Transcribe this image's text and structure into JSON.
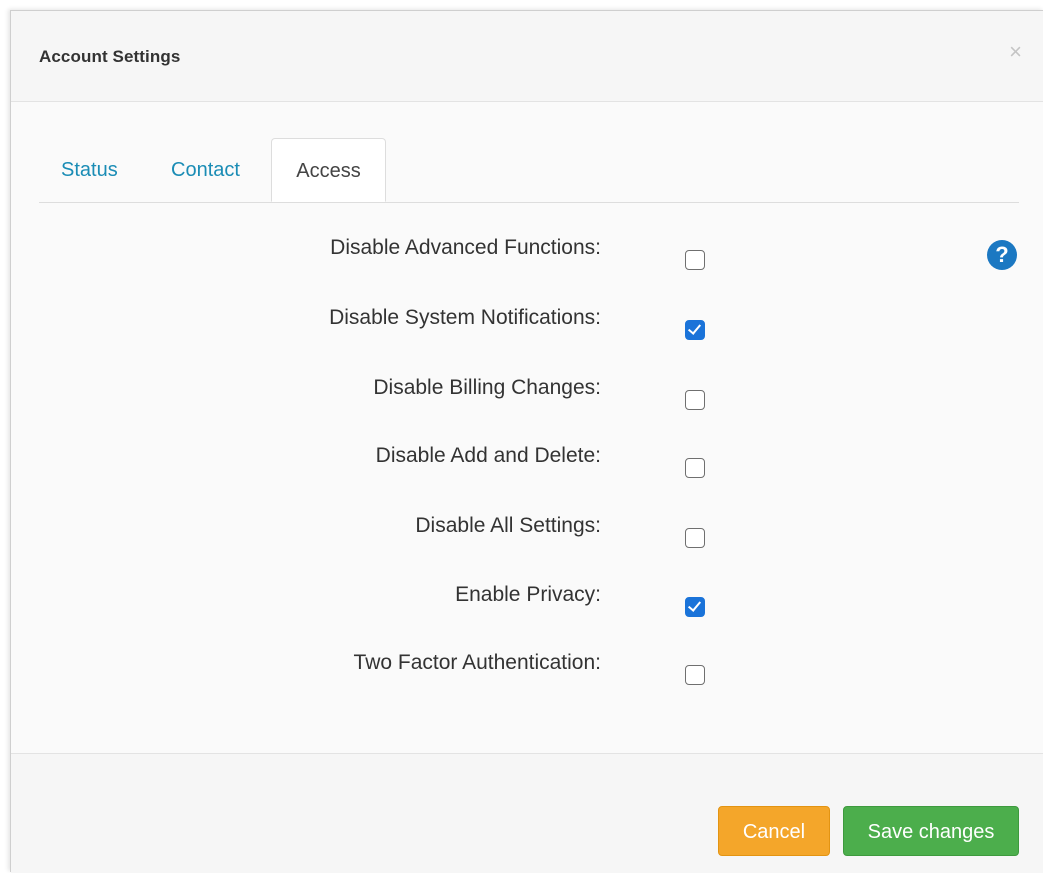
{
  "dialog": {
    "title": "Account Settings",
    "close_glyph": "×"
  },
  "tabs": [
    {
      "label": "Status",
      "active": false
    },
    {
      "label": "Contact",
      "active": false
    },
    {
      "label": "Access",
      "active": true
    }
  ],
  "help": {
    "glyph": "?"
  },
  "settings": [
    {
      "label": "Disable Advanced Functions:",
      "checked": false
    },
    {
      "label": "Disable System Notifications:",
      "checked": true
    },
    {
      "label": "Disable Billing Changes:",
      "checked": false
    },
    {
      "label": "Disable Add and Delete:",
      "checked": false
    },
    {
      "label": "Disable All Settings:",
      "checked": false
    },
    {
      "label": "Enable Privacy:",
      "checked": true
    },
    {
      "label": "Two Factor Authentication:",
      "checked": false
    }
  ],
  "footer": {
    "cancel_label": "Cancel",
    "save_label": "Save changes"
  },
  "colors": {
    "tab_link": "#1a8cb5",
    "checkbox_checked": "#1a73d9",
    "help_icon": "#1b78c2",
    "cancel_button": "#f4a62a",
    "save_button": "#4cae4c"
  }
}
